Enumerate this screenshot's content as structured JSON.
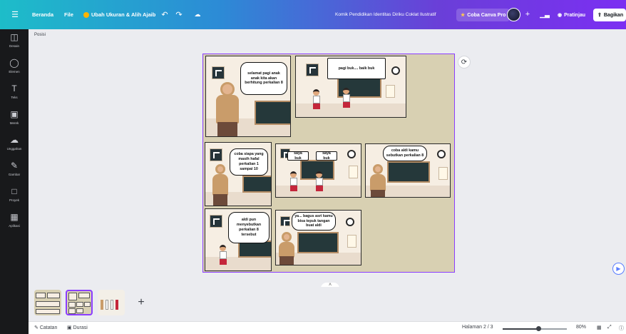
{
  "topbar": {
    "menu_icon": "hamburger-icon",
    "home": "Beranda",
    "file": "File",
    "resize": "Ubah Ukuran & Alih Ajaib",
    "undo_icon": "undo-icon",
    "redo_icon": "redo-icon",
    "cloud_icon": "cloud-saved-icon",
    "doc_title": "Komik Pendidikan Identitas Diriku Coklat Ilustratif",
    "pro_button": "Coba Canva Pro",
    "add_icon": "plus-icon",
    "chart_icon": "bar-chart-icon",
    "preview": "Pratinjau",
    "share": "Bagikan"
  },
  "sidebar": {
    "items": [
      {
        "label": "Desain",
        "icon": "layout-icon"
      },
      {
        "label": "Elemen",
        "icon": "shapes-icon"
      },
      {
        "label": "Teks",
        "icon": "text-icon"
      },
      {
        "label": "Merek",
        "icon": "brand-icon"
      },
      {
        "label": "Unggahan",
        "icon": "upload-icon"
      },
      {
        "label": "Gambar",
        "icon": "draw-icon"
      },
      {
        "label": "Proyek",
        "icon": "folder-icon"
      },
      {
        "label": "Aplikasi",
        "icon": "apps-icon"
      }
    ]
  },
  "page_label": "Posisi",
  "comic": {
    "p1": "selamat pagi anak anak kita akan berhitung perkalian 8",
    "p2": "pagi buk.... baik buk",
    "p3": "coba siapa yang masih hafal perkalian 1 sampai 10",
    "p4a": "saya buk",
    "p4b": "saya buk",
    "p5": "coba aldi kamu sebutkan perkalian 8",
    "p6": "aldi pun menyebutkan perkalian 8 tersebut",
    "p7": "ya... bagus asri kamu bisa tepuk tangan buat aldi"
  },
  "bottombar": {
    "notes": "Catatan",
    "duration": "Durasi",
    "page_indicator": "Halaman 2 / 3",
    "zoom": "80%",
    "zoom_fraction": 0.55
  },
  "colors": {
    "accent": "#8b3dff",
    "canvas_bg": "#d8d0b2"
  }
}
